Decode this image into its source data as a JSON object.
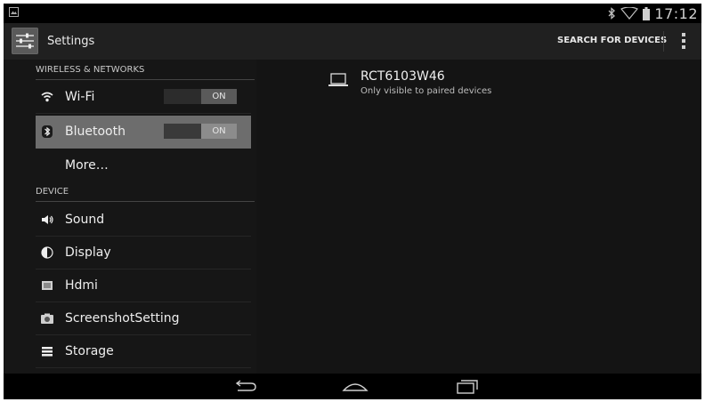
{
  "status_bar": {
    "time": "17:12",
    "icons": [
      "notification-icon",
      "bluetooth-icon",
      "wifi-icon",
      "battery-icon"
    ]
  },
  "action_bar": {
    "title": "Settings",
    "search_label": "SEARCH FOR DEVICES",
    "icons": [
      "settings-app-icon",
      "overflow-menu-icon"
    ]
  },
  "sidebar": {
    "sections": [
      {
        "header": "WIRELESS & NETWORKS",
        "items": [
          {
            "label": "Wi-Fi",
            "icon": "wifi-icon",
            "toggle": "ON",
            "selected": false
          },
          {
            "label": "Bluetooth",
            "icon": "bluetooth-icon",
            "toggle": "ON",
            "selected": true
          },
          {
            "label": "More…",
            "icon": "",
            "selected": false
          }
        ]
      },
      {
        "header": "DEVICE",
        "items": [
          {
            "label": "Sound",
            "icon": "sound-icon"
          },
          {
            "label": "Display",
            "icon": "display-icon"
          },
          {
            "label": "Hdmi",
            "icon": "hdmi-icon"
          },
          {
            "label": "ScreenshotSetting",
            "icon": "camera-icon"
          },
          {
            "label": "Storage",
            "icon": "storage-icon"
          }
        ]
      }
    ]
  },
  "detail": {
    "device_name": "RCT6103W46",
    "device_subtitle": "Only visible to paired devices",
    "icon": "laptop-icon"
  },
  "nav_bar": {
    "icons": [
      "back-icon",
      "home-icon",
      "recent-apps-icon"
    ]
  },
  "colors": {
    "background": "#111111",
    "selected_row": "#6d6d6d",
    "text": "#f2f2f2"
  }
}
